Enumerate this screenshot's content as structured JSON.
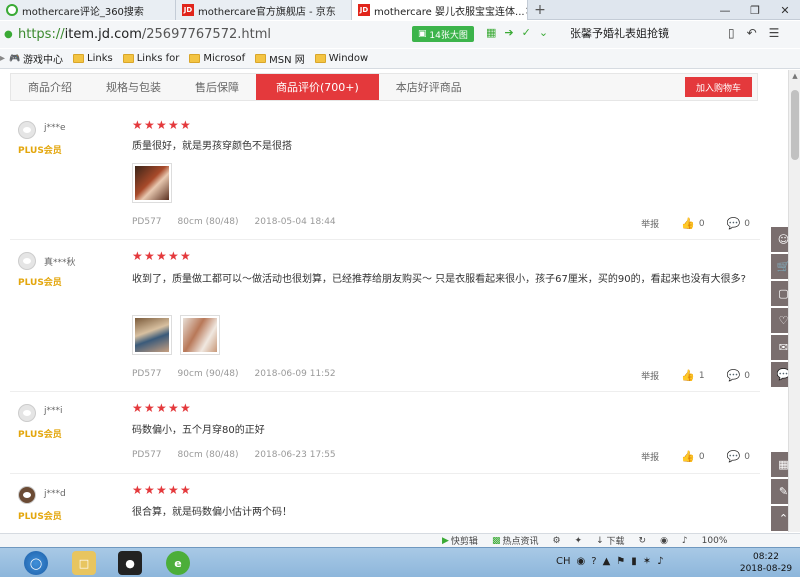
{
  "browser": {
    "tabs": [
      {
        "label": "mothercare评论_360搜索",
        "favicon": "360-search-icon"
      },
      {
        "label": "mothercare官方旗舰店 - 京东",
        "favicon": "jd-icon"
      },
      {
        "label": "mothercare 婴儿衣服宝宝连体...",
        "favicon": "jd-icon",
        "close": "×"
      }
    ],
    "new_tab": "+",
    "window_controls": [
      "—",
      "❐",
      "✕"
    ],
    "url_scheme": "https://",
    "url_host": "item.jd.com",
    "url_path": "/25697767572.html",
    "weather": "14张大图",
    "search_suggestion": "张馨予婚礼表姐抢镜"
  },
  "bookmarks": [
    {
      "label": "游戏中心",
      "icon": "gamepad-icon"
    },
    {
      "label": "Links",
      "icon": "folder-icon"
    },
    {
      "label": "Links for",
      "icon": "folder-icon"
    },
    {
      "label": "Microsof",
      "icon": "folder-icon"
    },
    {
      "label": "MSN 网",
      "icon": "folder-icon"
    },
    {
      "label": "Window",
      "icon": "folder-icon"
    }
  ],
  "product_nav": {
    "tabs": [
      "商品介绍",
      "规格与包装",
      "售后保障",
      "商品评价(700+)",
      "本店好评商品"
    ],
    "active_index": 3,
    "cart_button": "加入购物车"
  },
  "reviews": [
    {
      "user": "j***e",
      "level": "PLUS会员",
      "rating": 5,
      "text": "质量很好，就是男孩穿颜色不是很搭",
      "images": 1,
      "model": "PD577",
      "size": "80cm (80/48)",
      "date": "2018-05-04 18:44",
      "report": "举报",
      "likes": "0",
      "comments": "0"
    },
    {
      "user": "真***秋",
      "level": "PLUS会员",
      "rating": 5,
      "text": "收到了，质量做工都可以～做活动也很划算，已经推荐给朋友购买～ 只是衣服看起来很小，孩子67厘米，买的90的，看起来也没有大很多?",
      "images": 2,
      "model": "PD577",
      "size": "90cm (90/48)",
      "date": "2018-06-09 11:52",
      "report": "举报",
      "likes": "1",
      "comments": "0"
    },
    {
      "user": "j***i",
      "level": "PLUS会员",
      "rating": 5,
      "text": "码数偏小，五个月穿80的正好",
      "images": 0,
      "model": "PD577",
      "size": "80cm (80/48)",
      "date": "2018-06-23 17:55",
      "report": "举报",
      "likes": "0",
      "comments": "0"
    },
    {
      "user": "j***d",
      "level": "PLUS会员",
      "rating": 5,
      "text": "很合算，就是码数偏小估计两个码！",
      "images": 0
    }
  ],
  "status_bar": {
    "items": [
      "快剪辑",
      "热点资讯",
      "下载",
      "100%"
    ]
  },
  "taskbar": {
    "input_method": "CH",
    "time": "08:22",
    "date": "2018-08-29"
  },
  "colors": {
    "accent": "#e4393c",
    "plus": "#e3a60c",
    "url_green": "#3aaa35"
  }
}
